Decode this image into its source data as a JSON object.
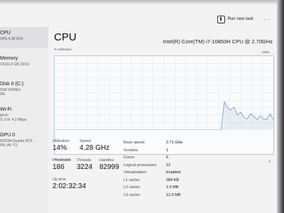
{
  "toolbar": {
    "run_new_task": "Run new task",
    "more": "···"
  },
  "sidebar": {
    "items": [
      {
        "title": "CPU",
        "sub": "14%  4.28 GHz",
        "sub2": ""
      },
      {
        "title": "Memory",
        "sub": "3.5/31.8 GB (11%)",
        "sub2": ""
      },
      {
        "title": "Disk 0 (C:)",
        "sub": "SSD (NVMe)",
        "sub2": "0%"
      },
      {
        "title": "Wi-Fi",
        "sub": "Wi-Fi",
        "sub2": "S: 0  R: 4.2 Mbps"
      },
      {
        "title": "GPU 0",
        "sub": "NVIDIA Quadro RTX ...",
        "sub2": "0% (40 °C)"
      }
    ]
  },
  "cpu": {
    "title": "CPU",
    "model": "Intel(R) Core(TM) i7-10850H CPU @ 2.70GHz",
    "util_label": "% Utilization",
    "max_label": "100%",
    "secs_label": "60 seconds",
    "zero_label": "0"
  },
  "stats": {
    "utilization_label": "Utilization",
    "utilization": "14%",
    "speed_label": "Speed",
    "speed": "4.28 GHz",
    "processes_label": "Processes",
    "processes": "186",
    "threads_label": "Threads",
    "threads": "3224",
    "handles_label": "Handles",
    "handles": "82999",
    "uptime_label": "Up time",
    "uptime": "2:02:32:34"
  },
  "details": [
    {
      "key": "Base speed:",
      "value": "2.71 GHz"
    },
    {
      "key": "Sockets:",
      "value": "1"
    },
    {
      "key": "Cores:",
      "value": "6"
    },
    {
      "key": "Logical processors:",
      "value": "12"
    },
    {
      "key": "Virtualization:",
      "value": "Enabled"
    },
    {
      "key": "L1 cache:",
      "value": "384 KB"
    },
    {
      "key": "L2 cache:",
      "value": "1.5 MB"
    },
    {
      "key": "L3 cache:",
      "value": "12.0 MB"
    }
  ],
  "graph": {
    "color": "#8aa9c9",
    "utilization_history": [
      0,
      0,
      0,
      0,
      0,
      0,
      0,
      0,
      0,
      0,
      0,
      0,
      0,
      0,
      0,
      0,
      0,
      0,
      0,
      0,
      0,
      0,
      0,
      0,
      0,
      0,
      0,
      0,
      0,
      0,
      0,
      0,
      0,
      0,
      0,
      0,
      0,
      0,
      0,
      0,
      0,
      0,
      0,
      0,
      0,
      0,
      0,
      0,
      0,
      0,
      0,
      0,
      38,
      30,
      27,
      31,
      20,
      24,
      17,
      15,
      22,
      18,
      14,
      19,
      15,
      14,
      22,
      14
    ]
  }
}
